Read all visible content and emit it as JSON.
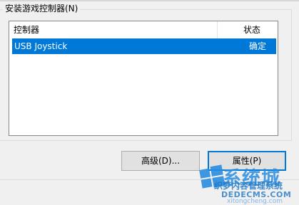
{
  "group": {
    "label": "安装游戏控制器(N)"
  },
  "list": {
    "columns": [
      "控制器",
      "状态"
    ],
    "rows": [
      {
        "name": "USB Joystick",
        "status": "确定",
        "selected": true
      }
    ]
  },
  "buttons": {
    "advanced": "高级(D)...",
    "properties": "属性(P)"
  },
  "watermark": {
    "site": "系统城",
    "chinese": "织梦内容管理系统",
    "domain": "DEDECMS.COM",
    "url": "xitongcheng.com"
  },
  "colors": {
    "selection": "#0078d7",
    "watermark": "#2a8de0"
  }
}
